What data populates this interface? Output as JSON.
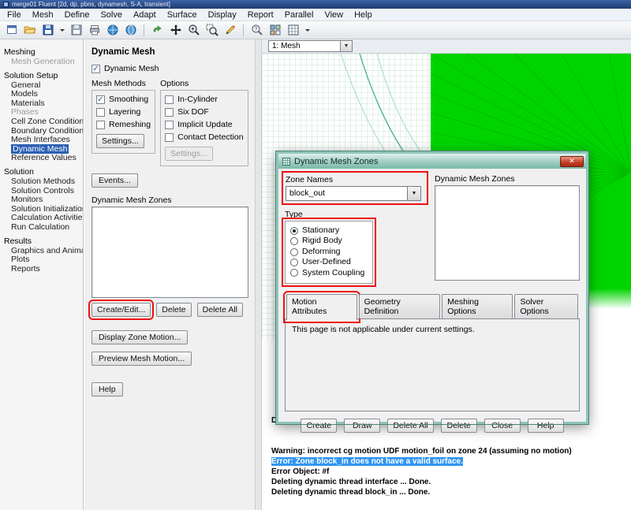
{
  "window": {
    "title": "merge01 Fluent [2d, dp, pbns, dynamesh, S-A, transient]"
  },
  "menu": {
    "items": [
      "File",
      "Mesh",
      "Define",
      "Solve",
      "Adapt",
      "Surface",
      "Display",
      "Report",
      "Parallel",
      "View",
      "Help"
    ]
  },
  "toolbar": {
    "icons": [
      "new-window-icon",
      "open-folder-icon",
      "save-icon",
      "save-dropdown-icon",
      "save-data-icon",
      "print-icon",
      "info-sphere-icon",
      "web-sphere-icon",
      "sync-view-icon",
      "pan-icon",
      "zoom-in-icon",
      "zoom-box-icon",
      "probe-pencil-icon",
      "zoom-help-icon",
      "layer-grid-icon",
      "pattern-icon",
      "toolbar-dropdown-icon"
    ]
  },
  "sidebar": {
    "items": [
      {
        "label": "Meshing",
        "kind": "header"
      },
      {
        "label": "Mesh Generation",
        "kind": "item",
        "state": "disabled"
      },
      {
        "label": "Solution Setup",
        "kind": "header"
      },
      {
        "label": "General",
        "kind": "item"
      },
      {
        "label": "Models",
        "kind": "item"
      },
      {
        "label": "Materials",
        "kind": "item"
      },
      {
        "label": "Phases",
        "kind": "item",
        "state": "disabled"
      },
      {
        "label": "Cell Zone Conditions",
        "kind": "item"
      },
      {
        "label": "Boundary Conditions",
        "kind": "item"
      },
      {
        "label": "Mesh Interfaces",
        "kind": "item"
      },
      {
        "label": "Dynamic Mesh",
        "kind": "item",
        "state": "selected"
      },
      {
        "label": "Reference Values",
        "kind": "item"
      },
      {
        "label": "Solution",
        "kind": "header"
      },
      {
        "label": "Solution Methods",
        "kind": "item"
      },
      {
        "label": "Solution Controls",
        "kind": "item"
      },
      {
        "label": "Monitors",
        "kind": "item"
      },
      {
        "label": "Solution Initialization",
        "kind": "item"
      },
      {
        "label": "Calculation Activities",
        "kind": "item"
      },
      {
        "label": "Run Calculation",
        "kind": "item"
      },
      {
        "label": "Results",
        "kind": "header"
      },
      {
        "label": "Graphics and Animations",
        "kind": "item"
      },
      {
        "label": "Plots",
        "kind": "item"
      },
      {
        "label": "Reports",
        "kind": "item"
      }
    ]
  },
  "task_panel": {
    "title": "Dynamic Mesh",
    "dynamic_mesh_label": "Dynamic Mesh",
    "mesh_methods": {
      "title": "Mesh Methods",
      "items": [
        {
          "label": "Smoothing",
          "checked": true
        },
        {
          "label": "Layering",
          "checked": false
        },
        {
          "label": "Remeshing",
          "checked": false
        }
      ],
      "settings_label": "Settings..."
    },
    "options": {
      "title": "Options",
      "items": [
        {
          "label": "In-Cylinder",
          "checked": false
        },
        {
          "label": "Six DOF",
          "checked": false
        },
        {
          "label": "Implicit Update",
          "checked": false
        },
        {
          "label": "Contact Detection",
          "checked": false
        }
      ],
      "settings_label": "Settings..."
    },
    "events_label": "Events...",
    "zones_label": "Dynamic Mesh Zones",
    "create_edit_label": "Create/Edit...",
    "delete_label": "Delete",
    "delete_all_label": "Delete All",
    "display_zone_motion_label": "Display Zone Motion...",
    "preview_mesh_motion_label": "Preview Mesh Motion...",
    "help_label": "Help"
  },
  "graphics": {
    "view_selector": "1: Mesh"
  },
  "dialog": {
    "title": "Dynamic Mesh Zones",
    "zone_names_label": "Zone Names",
    "zone_name_value": "block_out",
    "type_label": "Type",
    "type_options": [
      {
        "label": "Stationary",
        "selected": true
      },
      {
        "label": "Rigid Body",
        "selected": false
      },
      {
        "label": "Deforming",
        "selected": false
      },
      {
        "label": "User-Defined",
        "selected": false
      },
      {
        "label": "System Coupling",
        "selected": false
      }
    ],
    "zones_list_label": "Dynamic Mesh Zones",
    "tabs": [
      {
        "label": "Motion Attributes",
        "active": true
      },
      {
        "label": "Geometry Definition",
        "active": false
      },
      {
        "label": "Meshing Options",
        "active": false
      },
      {
        "label": "Solver Options",
        "active": false
      }
    ],
    "tab_message": "This page is not applicable under current settings.",
    "buttons": [
      "Create",
      "Draw",
      "Delete All",
      "Delete",
      "Close",
      "Help"
    ]
  },
  "console": {
    "lines": [
      {
        "text": "D",
        "highlight": false
      },
      {
        "text": "",
        "highlight": false
      },
      {
        "text": "",
        "highlight": false
      },
      {
        "text": "Warning: incorrect cg motion UDF motion_foil on zone 24 (assuming no motion)",
        "highlight": false
      },
      {
        "text": "Error: Zone block_in does not have a valid surface.",
        "highlight": true
      },
      {
        "text": "Error Object: #f",
        "highlight": false
      },
      {
        "text": "Deleting dynamic thread interface ... Done.",
        "highlight": false
      },
      {
        "text": "Deleting dynamic thread block_in ... Done.",
        "highlight": false
      }
    ]
  },
  "colors": {
    "annotation_red": "#ee1111",
    "console_selection_blue": "#3296f0",
    "tree_selection_blue": "#2b5fb4",
    "mesh_green": "#00d400",
    "dialog_titlebar_teal": "#8fc4ba",
    "titlebar_navy": "#1d3a6e"
  }
}
